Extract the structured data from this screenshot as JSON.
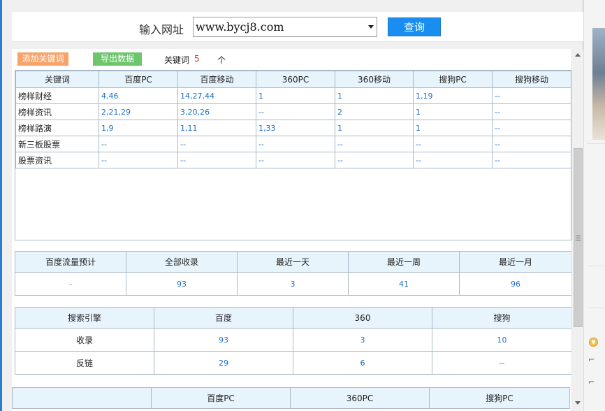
{
  "url_bar": {
    "label": "输入网址",
    "value": "www.bycj8.com",
    "query_button": "查询"
  },
  "toolbar": {
    "add_keyword": "添加关键词",
    "export_data": "导出数据",
    "keyword_label": "关键词",
    "keyword_count": "5",
    "keyword_unit": "个"
  },
  "keyword_table": {
    "headers": [
      "关键词",
      "百度PC",
      "百度移动",
      "360PC",
      "360移动",
      "搜狗PC",
      "搜狗移动"
    ],
    "rows": [
      [
        "榜样财经",
        "4,46",
        "14,27,44",
        "1",
        "1",
        "1,19",
        "--"
      ],
      [
        "榜样资讯",
        "2,21,29",
        "3,20,26",
        "--",
        "2",
        "1",
        "--"
      ],
      [
        "榜样路演",
        "1,9",
        "1,11",
        "1,33",
        "1",
        "1",
        "--"
      ],
      [
        "新三板股票",
        "--",
        "--",
        "--",
        "--",
        "--",
        "--"
      ],
      [
        "股票资讯",
        "--",
        "--",
        "--",
        "--",
        "--",
        "--"
      ]
    ]
  },
  "summary_table": {
    "headers": [
      "百度流量预计",
      "全部收录",
      "最近一天",
      "最近一周",
      "最近一月"
    ],
    "values": [
      "-",
      "93",
      "3",
      "41",
      "96"
    ]
  },
  "engine_table": {
    "headers": [
      "搜索引擎",
      "百度",
      "360",
      "搜狗"
    ],
    "rows": [
      [
        "收录",
        "93",
        "3",
        "10"
      ],
      [
        "反链",
        "29",
        "6",
        "--"
      ]
    ]
  },
  "bottom_table": {
    "headers": [
      "",
      "百度PC",
      "360PC",
      "搜狗PC"
    ]
  },
  "colors": {
    "accent_blue": "#1a8ef0",
    "add_button": "#f7a36a",
    "export_button": "#6cc66c",
    "count_red": "#e0282a",
    "link_blue": "#1b6fc8",
    "header_bg": "#e8f4fc"
  }
}
